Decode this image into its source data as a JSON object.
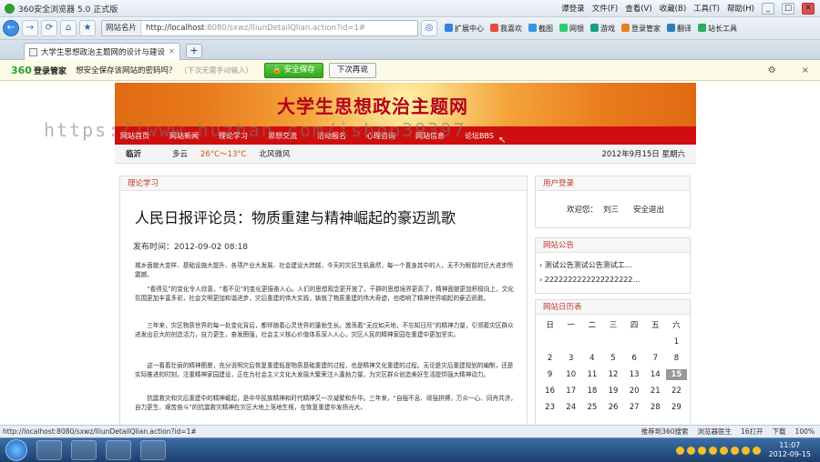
{
  "browser": {
    "title": "360安全浏览器 5.0 正式版",
    "menus": [
      "谭登录",
      "文件(F)",
      "查看(V)",
      "收藏(B)",
      "工具(T)",
      "帮助(H)"
    ],
    "address_pill": "网站名片",
    "url_host": "http://localhost",
    "url_rest": ":8080/sxwz/lliunDetailQlian.action?id=1#",
    "toolbar": [
      "扩展中心",
      "我喜欢",
      "截图",
      "网银",
      "游戏",
      "登录管家",
      "翻译",
      "站长工具"
    ],
    "tab_title": "大学生思想政治主题网的设计与建设",
    "pw_brand": "360",
    "pw_brand_sub": "登录管家",
    "pw_question": "想安全保存该网站的密码吗？",
    "pw_hint": "（下次无需手动输入）",
    "pw_save": "安全保存",
    "pw_later": "下次再说"
  },
  "site": {
    "banner_title": "大学生思想政治主题网",
    "nav": [
      "网站首页",
      "网站新闻",
      "理论学习",
      "思想交流",
      "活动报名",
      "心理咨询",
      "网站信息",
      "论坛BBS"
    ],
    "city": "临沂",
    "weather": "多云",
    "temp": "26°C～13°C",
    "wind": "北风微风",
    "date": "2012年9月15日 星期六",
    "watermark": "https://www.huzhan.com/ishop39397"
  },
  "article": {
    "section": "理论学习",
    "title": "人民日报评论员：物质重建与精神崛起的豪迈凯歌",
    "date_label": "发布时间：2012-09-02 08:18",
    "paragraphs": [
      "城乡面貌大变样、基础设施大提升、各项产业大发展、社会建设大跨越，今天的灾区生机盎然，每一个置身其中的人，无不为眼前的巨大进步所震撼。",
      "“看得见”的变化令人欣喜，“看不见”的变化更振奋人心。人们的思想观念更开放了，干群的思想境界更高了，精神面貌更加积极向上，文化氛围更加丰富多彩，社会文明更加和谐进步，灾后重建的伟大实践，铸就了物质重建的伟大奇迹，也唱响了精神世界崛起的豪迈凯歌。",
      "三年来，灾区物质世界的每一处变化背后，都伴随着心灵世界的蓬勃生长。激荡着“无应如天地，不忘知日月”的精神力量，引领着灾区群众进发出巨大的创造活力，自力更生，奋发图强，社会主义核心价值体系深入人心，灾区人民的精神家园在重建中更加坚实。",
      "这一看着壮丽的精神图景，充分说明灾后恢复重建既是物质基础重建的过程，也是精神文化重建的过程。无论是灾后重建规划的编制，还是实际推进的时刻，注重精神家园建设，正在为社会主义文化大发展大繁荣注入蓬勃力量，为灾区群众创造美好生活提供强大精神动力。",
      "抗震救灾和灾后重建中的精神崛起，是中华民族精神和时代精神又一次凝聚和升华。三年来，“自强不息、顽强拼搏，万众一心、同舟共济，自力更生、艰苦奋斗”的抗震救灾精神在灾区大地上落地生根，在恢复重建中发扬光大。"
    ]
  },
  "sidebar": {
    "user_section": "用户登录",
    "welcome": "欢迎您：",
    "username": "刘三",
    "logout": "安全退出",
    "notice_section": "网站公告",
    "notices": [
      "测试公告测试公告测试工…",
      "2222222222222222222…"
    ],
    "calendar_section": "网站日历表",
    "weekdays": [
      "日",
      "一",
      "二",
      "三",
      "四",
      "五",
      "六"
    ],
    "days": [
      "",
      "",
      "",
      "",
      "",
      "",
      "1",
      "2",
      "3",
      "4",
      "5",
      "6",
      "7",
      "8",
      "9",
      "10",
      "11",
      "12",
      "13",
      "14",
      "15",
      "16",
      "17",
      "18",
      "19",
      "20",
      "21",
      "22",
      "23",
      "24",
      "25",
      "26",
      "27",
      "28",
      "29"
    ],
    "today": "15"
  },
  "statusbar": {
    "link": "http://localhost:8080/sxwz/lliunDetailQlian.action?id=1#",
    "items": [
      "推荐到360搜索",
      "浏览器医生",
      "16打开",
      "下载",
      "100%"
    ]
  },
  "taskbar": {
    "time": "11:07",
    "date": "2012-09-15"
  },
  "colors": {
    "nav_red": "#cf0f0f",
    "banner_orange": "#e9791d",
    "title_red": "#b3001b",
    "save_green": "#35a51f"
  }
}
